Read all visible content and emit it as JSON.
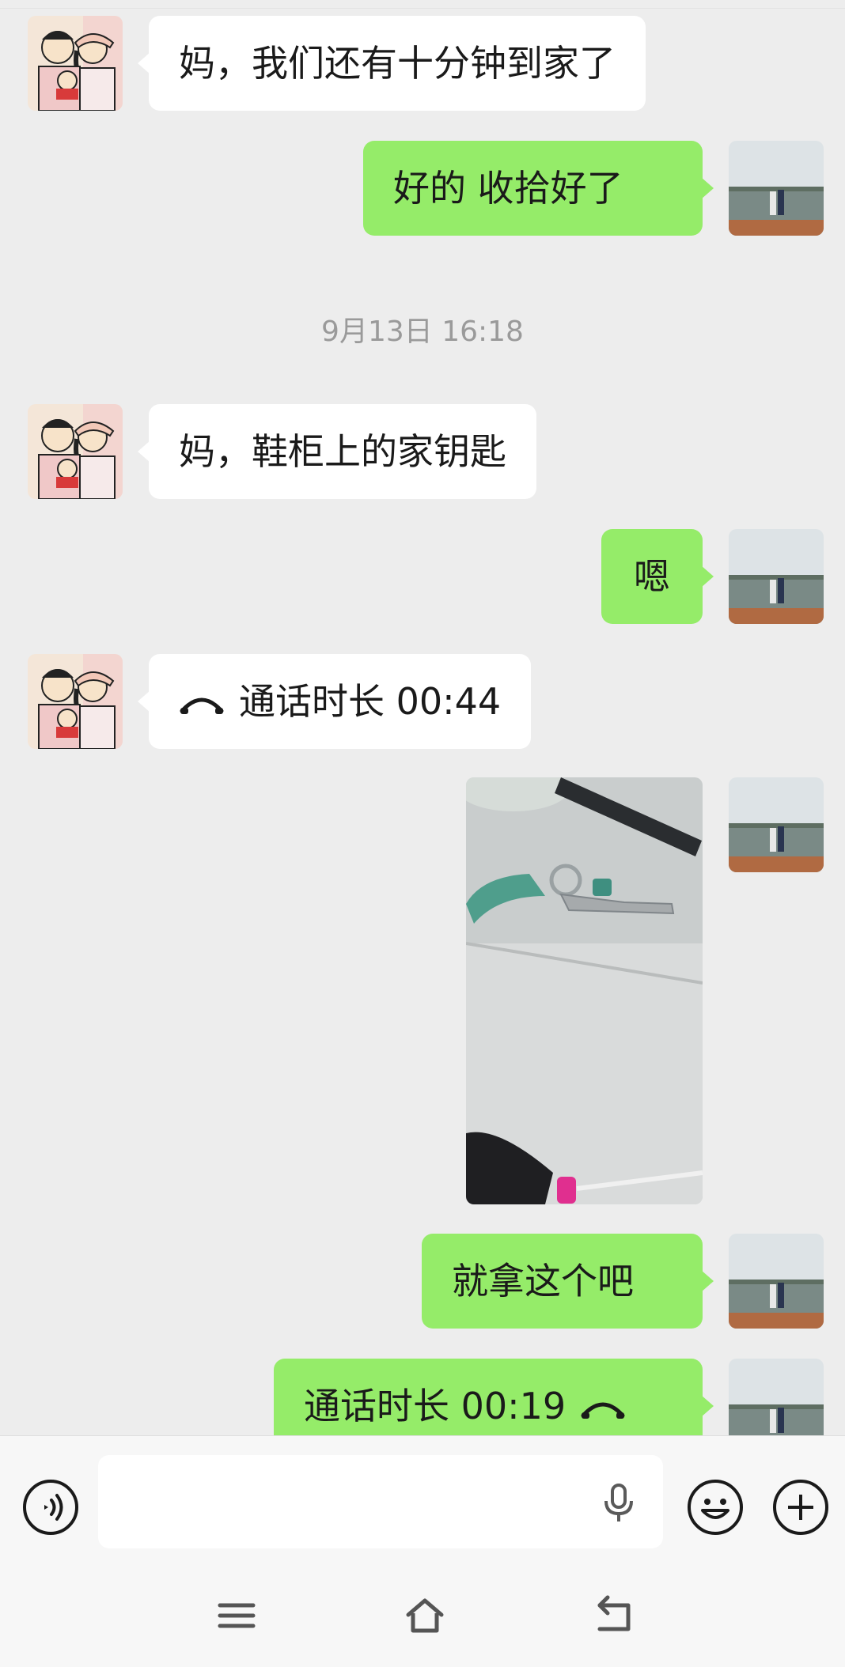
{
  "messages": [
    {
      "side": "in",
      "text": "妈，我们还有十分钟到家了"
    },
    {
      "side": "out",
      "text": "好的 收拾好了"
    },
    {
      "side": "in",
      "text": "妈，鞋柜上的家钥匙"
    },
    {
      "side": "out",
      "text": "嗯"
    },
    {
      "side": "in",
      "text": "通话时长 00:44",
      "icon": "phone-hangup-icon"
    },
    {
      "side": "out",
      "text": "就拿这个吧"
    },
    {
      "side": "out",
      "text": "通话时长 00:19",
      "icon": "phone-hangup-icon"
    }
  ],
  "timestamp": "9月13日 16:18",
  "photo_message": {
    "side": "out",
    "alt_icon": "image-of-keys"
  },
  "input_bar": {
    "voice_icon": "voice-mode-icon",
    "mic_icon": "microphone-icon",
    "emoji_icon": "emoji-icon",
    "plus_icon": "plus-icon",
    "text_value": ""
  },
  "nav": {
    "menu_icon": "menu-icon",
    "home_icon": "home-icon",
    "back_icon": "back-icon"
  },
  "colors": {
    "background": "#ededed",
    "out_bubble": "#95ec69",
    "in_bubble": "#ffffff"
  }
}
